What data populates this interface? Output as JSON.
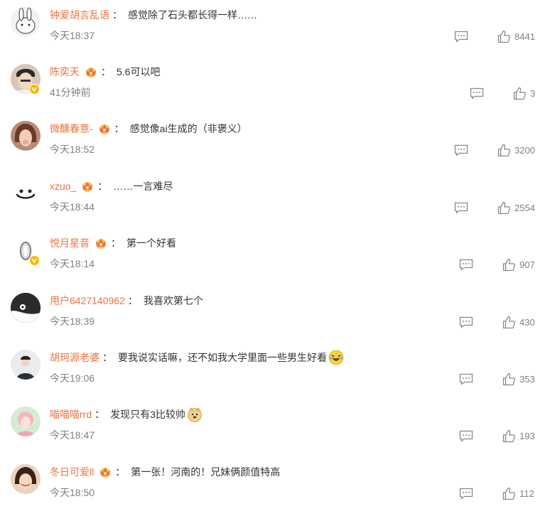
{
  "colors": {
    "username": "#eb7340",
    "text": "#333333",
    "meta": "#808080",
    "badge": "#f5b800"
  },
  "icons": {
    "reply": "comment-bubble-icon",
    "like": "thumbs-up-icon",
    "member": "crown-badge-icon",
    "verified": "verified-v-icon"
  },
  "comments": [
    {
      "user": "钟爱胡言乱语",
      "colon": "：",
      "text": "感觉除了石头都长得一样……",
      "time": "今天18:37",
      "likes": "8441"
    },
    {
      "user": "陈奕天",
      "colon": "：",
      "text": "5.6可以吧",
      "time": "41分钟前",
      "likes": "3"
    },
    {
      "user": "微醺春意-",
      "colon": "：",
      "text": "感觉像ai生成的（非褒义）",
      "time": "今天18:52",
      "likes": "3200"
    },
    {
      "user": "xzuo_",
      "colon": "：",
      "text": "……一言难尽",
      "time": "今天18:44",
      "likes": "2554"
    },
    {
      "user": "悦月星音",
      "colon": "：",
      "text": "第一个好看",
      "time": "今天18:14",
      "likes": "907"
    },
    {
      "user": "用户6427140962",
      "colon": "：",
      "text": "我喜欢第七个",
      "time": "今天18:39",
      "likes": "430"
    },
    {
      "user": "胡珂源老婆",
      "colon": "：",
      "text": "要我说实话嘛，还不如我大学里面一些男生好看",
      "time": "今天19:06",
      "likes": "353"
    },
    {
      "user": "喵喵喵rrd",
      "colon": "：",
      "text": "发现只有3比较帅",
      "time": "今天18:47",
      "likes": "193"
    },
    {
      "user": "冬日可爱ll",
      "colon": "：",
      "text": "第一张！河南的！兄妹俩颜值特高",
      "time": "今天18:50",
      "likes": "112"
    }
  ]
}
